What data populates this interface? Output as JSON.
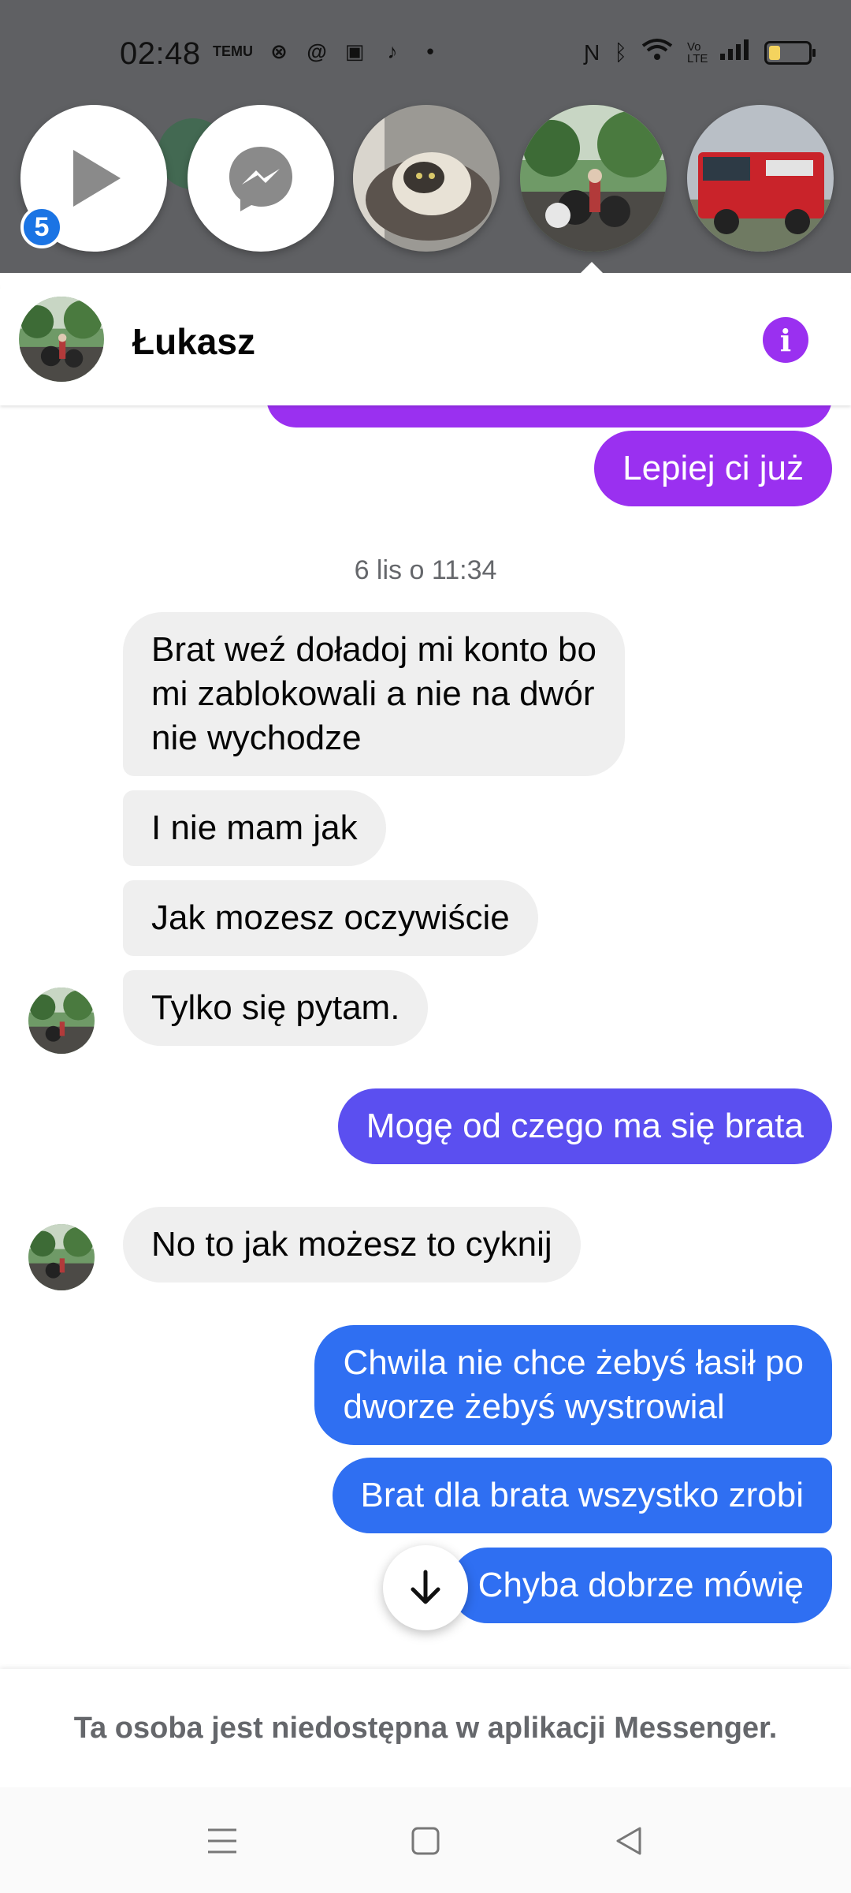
{
  "status_bar": {
    "time": "02:48",
    "app_icons": [
      "TEMU",
      "crossed-app-icon",
      "messenger-lite-icon",
      "app-icon",
      "tiktok-icon",
      "more-dot-icon"
    ],
    "network_label": "Vo LTE",
    "battery_level": 0.3
  },
  "chat_heads": {
    "unread_badge": "5",
    "items": [
      "video-play-head",
      "messenger-head",
      "cat-photo-head",
      "lukasz-head",
      "fire-truck-head"
    ]
  },
  "conversation": {
    "contact_name": "Łukasz",
    "messages": [
      {
        "dir": "out",
        "text": "Lepiej ci już"
      },
      {
        "dir": "time",
        "text": "6 lis o 11:34"
      },
      {
        "dir": "in",
        "lines": [
          "Brat weź doładoj mi konto bo",
          "mi zablokowali a nie na dwór",
          "nie wychodze"
        ]
      },
      {
        "dir": "in",
        "text": "I nie mam jak"
      },
      {
        "dir": "in",
        "text": "Jak mozesz oczywiście"
      },
      {
        "dir": "in",
        "text": "Tylko się pytam."
      },
      {
        "dir": "out",
        "text": "Mogę od czego ma się brata"
      },
      {
        "dir": "in",
        "text": "No to jak możesz to cyknij"
      },
      {
        "dir": "out",
        "lines": [
          "Chwila nie chce żebyś łasił po",
          "dworze żebyś wystrowial"
        ]
      },
      {
        "dir": "out",
        "text": "Brat dla brata wszystko zrobi"
      },
      {
        "dir": "out",
        "text": "Chyba dobrze mówię"
      }
    ],
    "unavailable_notice": "Ta osoba jest niedostępna w aplikacji Messenger."
  },
  "colors": {
    "outgoing_top": "#9a30f0",
    "outgoing_mid": "#5b4ff0",
    "outgoing_bottom": "#2f6ff2",
    "incoming": "#efefef",
    "accent": "#9a30f0"
  }
}
